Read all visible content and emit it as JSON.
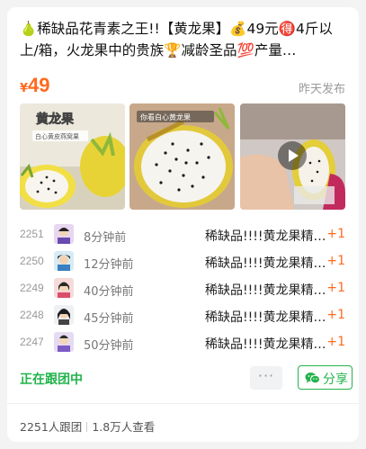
{
  "post": {
    "title": "🍐稀缺品花青素之王!!【黄龙果】💰49元🉐4斤以上/箱，火龙果中的贵族🏆减龄圣品💯产量…",
    "price_symbol": "¥",
    "price_value": "49",
    "posted_time": "昨天发布"
  },
  "media": {
    "items": [
      {
        "icon": "dragonfruit-photo",
        "overlay_title": "黄龙果",
        "overlay_caption": "白心黄皮燕窝果"
      },
      {
        "icon": "dragonfruit-cut-photo",
        "overlay_caption": "你看白心黄龙果"
      },
      {
        "icon": "video-thumbnail",
        "has_play": true
      }
    ]
  },
  "orders": [
    {
      "no": "2251",
      "time": "8分钟前",
      "product": "稀缺品!!!!黄龙果精…",
      "qty": "+1"
    },
    {
      "no": "2250",
      "time": "12分钟前",
      "product": "稀缺品!!!!黄龙果精…",
      "qty": "+1"
    },
    {
      "no": "2249",
      "time": "40分钟前",
      "product": "稀缺品!!!!黄龙果精…",
      "qty": "+1"
    },
    {
      "no": "2248",
      "time": "45分钟前",
      "product": "稀缺品!!!!黄龙果精…",
      "qty": "+1"
    },
    {
      "no": "2247",
      "time": "50分钟前",
      "product": "稀缺品!!!!黄龙果精…",
      "qty": "+1"
    }
  ],
  "actions": {
    "status": "正在跟团中",
    "more_label": "···",
    "share_label": "分享"
  },
  "stats": {
    "followers": "2251人跟团",
    "views": "1.8万人查看"
  },
  "colors": {
    "accent_orange": "#ff6a1f",
    "accent_green": "#21b34b"
  }
}
